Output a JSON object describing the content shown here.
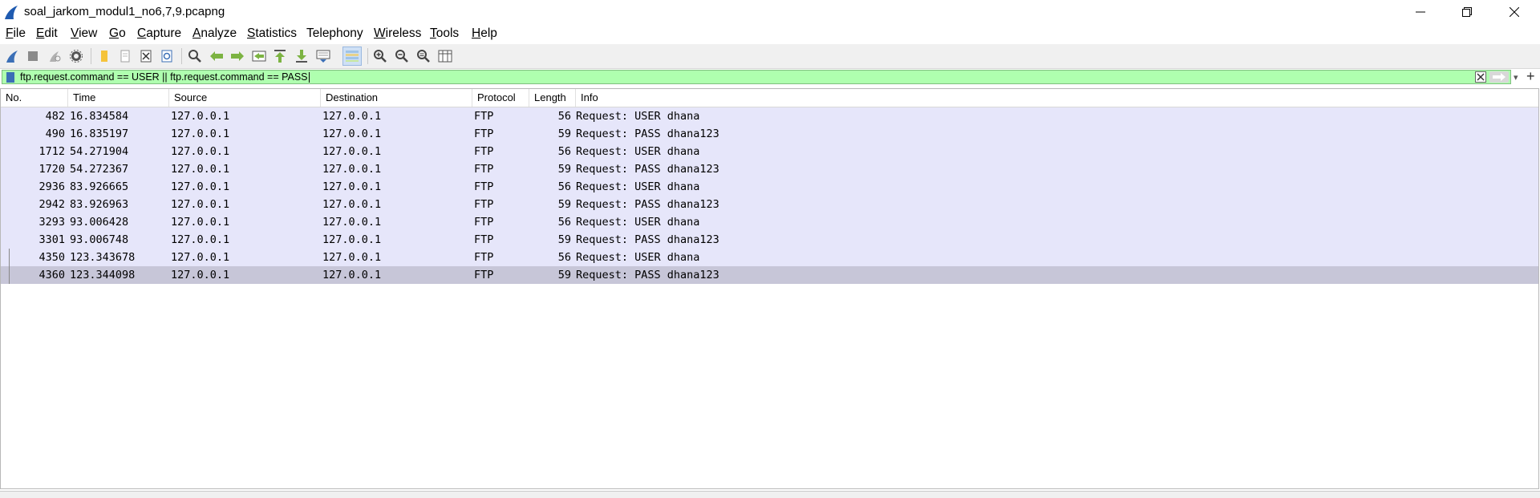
{
  "window": {
    "title": "soal_jarkom_modul1_no6,7,9.pcapng"
  },
  "menu": [
    {
      "label": "File",
      "underline": "F",
      "rest": "ile"
    },
    {
      "label": "Edit",
      "underline": "E",
      "rest": "dit"
    },
    {
      "label": "View",
      "underline": "V",
      "rest": "iew"
    },
    {
      "label": "Go",
      "underline": "G",
      "rest": "o"
    },
    {
      "label": "Capture",
      "underline": "C",
      "rest": "apture"
    },
    {
      "label": "Analyze",
      "underline": "A",
      "rest": "nalyze"
    },
    {
      "label": "Statistics",
      "underline": "S",
      "rest": "tatistics"
    },
    {
      "label": "Telephony",
      "underline": "",
      "rest": "Telephony"
    },
    {
      "label": "Wireless",
      "underline": "W",
      "rest": "ireless"
    },
    {
      "label": "Tools",
      "underline": "T",
      "rest": "ools"
    },
    {
      "label": "Help",
      "underline": "H",
      "rest": "elp"
    }
  ],
  "filter": {
    "value": "ftp.request.command == USER || ftp.request.command == PASS",
    "color": "#afffaf"
  },
  "columns": [
    "No.",
    "Time",
    "Source",
    "Destination",
    "Protocol",
    "Length",
    "Info"
  ],
  "packets": [
    {
      "no": "482",
      "time": "16.834584",
      "source": "127.0.0.1",
      "destination": "127.0.0.1",
      "protocol": "FTP",
      "length": "56",
      "info": "Request: USER dhana"
    },
    {
      "no": "490",
      "time": "16.835197",
      "source": "127.0.0.1",
      "destination": "127.0.0.1",
      "protocol": "FTP",
      "length": "59",
      "info": "Request: PASS dhana123"
    },
    {
      "no": "1712",
      "time": "54.271904",
      "source": "127.0.0.1",
      "destination": "127.0.0.1",
      "protocol": "FTP",
      "length": "56",
      "info": "Request: USER dhana"
    },
    {
      "no": "1720",
      "time": "54.272367",
      "source": "127.0.0.1",
      "destination": "127.0.0.1",
      "protocol": "FTP",
      "length": "59",
      "info": "Request: PASS dhana123"
    },
    {
      "no": "2936",
      "time": "83.926665",
      "source": "127.0.0.1",
      "destination": "127.0.0.1",
      "protocol": "FTP",
      "length": "56",
      "info": "Request: USER dhana"
    },
    {
      "no": "2942",
      "time": "83.926963",
      "source": "127.0.0.1",
      "destination": "127.0.0.1",
      "protocol": "FTP",
      "length": "59",
      "info": "Request: PASS dhana123"
    },
    {
      "no": "3293",
      "time": "93.006428",
      "source": "127.0.0.1",
      "destination": "127.0.0.1",
      "protocol": "FTP",
      "length": "56",
      "info": "Request: USER dhana"
    },
    {
      "no": "3301",
      "time": "93.006748",
      "source": "127.0.0.1",
      "destination": "127.0.0.1",
      "protocol": "FTP",
      "length": "59",
      "info": "Request: PASS dhana123"
    },
    {
      "no": "4350",
      "time": "123.343678",
      "source": "127.0.0.1",
      "destination": "127.0.0.1",
      "protocol": "FTP",
      "length": "56",
      "info": "Request: USER dhana"
    },
    {
      "no": "4360",
      "time": "123.344098",
      "source": "127.0.0.1",
      "destination": "127.0.0.1",
      "protocol": "FTP",
      "length": "59",
      "info": "Request: PASS dhana123",
      "selected": true
    }
  ],
  "colors": {
    "row_bg": "#e6e6fa",
    "row_selected": "#c7c6d8",
    "accent": "#3b6fb6"
  }
}
